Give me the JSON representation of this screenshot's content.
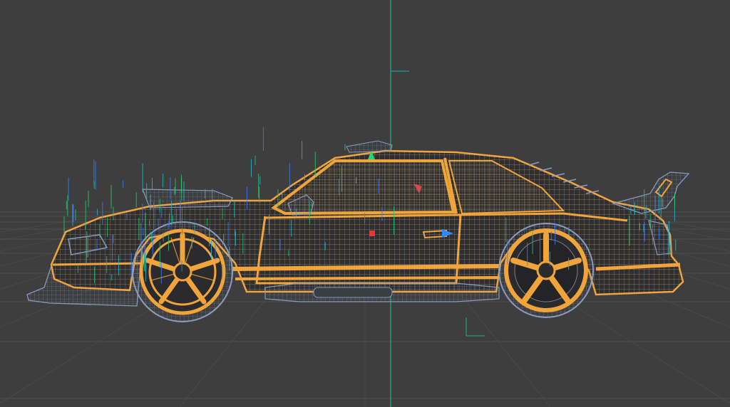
{
  "viewport": {
    "background": "#3e3e3e",
    "grid_color": "#555555",
    "axis_vertical_color": "#1fae8c"
  },
  "model": {
    "selection_color": "#f0a43c",
    "mesh_color": "#d7b98a",
    "unselected_color": "#8a9bbd",
    "dark_fill": "#2f2f31",
    "normal_colors": [
      "#29c46a",
      "#2ab6c8",
      "#3a7df0"
    ]
  },
  "gizmo": {
    "handle_red": "#e23a3a",
    "handle_blue": "#2f86ff",
    "handle_green": "#2bd36b"
  }
}
